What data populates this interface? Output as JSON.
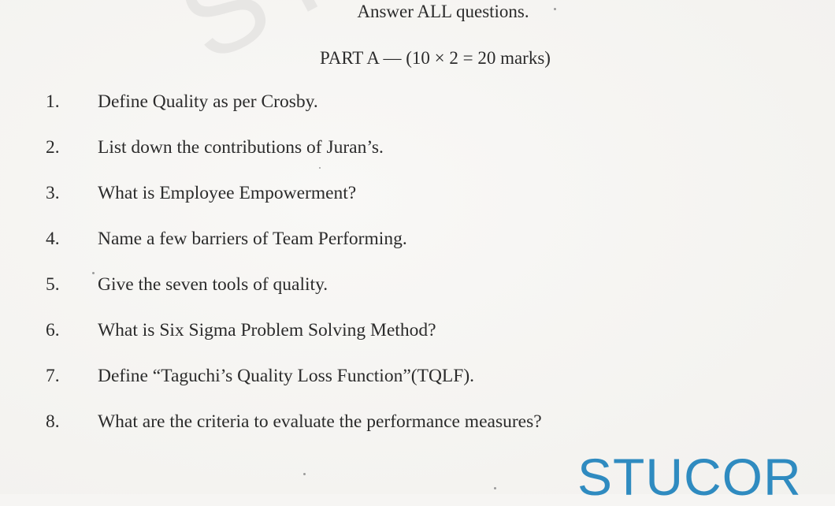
{
  "watermark": {
    "top_text": "ST",
    "bottom_text": "STUCOR"
  },
  "instructions": "Answer ALL questions.",
  "part_a": {
    "heading": "PART A — (10 × 2 = 20 marks)",
    "questions": [
      {
        "number": "1.",
        "text": "Define Quality as per Crosby."
      },
      {
        "number": "2.",
        "text": "List down the contributions of Juran’s."
      },
      {
        "number": "3.",
        "text": "What is Employee Empowerment?"
      },
      {
        "number": "4.",
        "text": "Name a few barriers of Team Performing."
      },
      {
        "number": "5.",
        "text": "Give the seven tools of quality."
      },
      {
        "number": "6.",
        "text": "What is Six Sigma Problem Solving Method?"
      },
      {
        "number": "7.",
        "text": "Define “Taguchi’s Quality Loss Function”(TQLF)."
      },
      {
        "number": "8.",
        "text": "What are the criteria to evaluate the performance measures?"
      }
    ]
  }
}
